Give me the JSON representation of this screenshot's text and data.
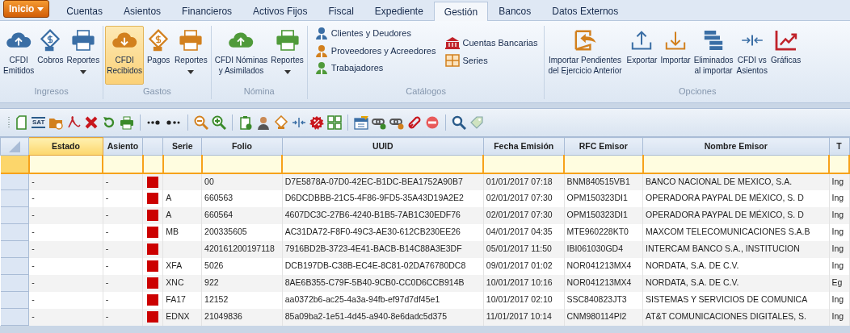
{
  "app_menu": {
    "label": "Inicio"
  },
  "tabs": [
    {
      "label": "Cuentas",
      "selected": false
    },
    {
      "label": "Asientos",
      "selected": false
    },
    {
      "label": "Financieros",
      "selected": false
    },
    {
      "label": "Activos Fijos",
      "selected": false
    },
    {
      "label": "Fiscal",
      "selected": false
    },
    {
      "label": "Expediente",
      "selected": false
    },
    {
      "label": "Gestión",
      "selected": true
    },
    {
      "label": "Bancos",
      "selected": false
    },
    {
      "label": "Datos Externos",
      "selected": false
    }
  ],
  "ribbon_groups": [
    {
      "label": "Ingresos",
      "buttons": [
        {
          "label": "CFDI Emitidos",
          "selected": false,
          "dropdown": false
        },
        {
          "label": "Cobros",
          "selected": false,
          "dropdown": false
        },
        {
          "label": "Reportes",
          "selected": false,
          "dropdown": true
        }
      ]
    },
    {
      "label": "Gastos",
      "buttons": [
        {
          "label": "CFDI Recibidos",
          "selected": true,
          "dropdown": false
        },
        {
          "label": "Pagos",
          "selected": false,
          "dropdown": false
        },
        {
          "label": "Reportes",
          "selected": false,
          "dropdown": true
        }
      ]
    },
    {
      "label": "Nómina",
      "buttons": [
        {
          "label": "CFDI Nóminas y Asimilados",
          "selected": false,
          "dropdown": false
        },
        {
          "label": "Reportes",
          "selected": false,
          "dropdown": true
        }
      ]
    },
    {
      "label": "Catálogos",
      "small_buttons": [
        {
          "label": "Clientes y Deudores"
        },
        {
          "label": "Proveedores y Acreedores"
        },
        {
          "label": "Trabajadores"
        },
        {
          "label": "Cuentas Bancarias"
        },
        {
          "label": "Series"
        }
      ]
    },
    {
      "label": "Opciones",
      "buttons": [
        {
          "label": "Importar Pendientes del Ejercicio Anterior",
          "selected": false,
          "dropdown": false
        },
        {
          "label": "Exportar",
          "selected": false,
          "dropdown": false
        },
        {
          "label": "Importar",
          "selected": false,
          "dropdown": false
        },
        {
          "label": "Eliminados al importar",
          "selected": false,
          "dropdown": false
        },
        {
          "label": "CFDI vs Asientos",
          "selected": false,
          "dropdown": false
        },
        {
          "label": "Gráficas",
          "selected": false,
          "dropdown": false
        }
      ]
    }
  ],
  "toolbar": {
    "sat_label": "SAT"
  },
  "table": {
    "columns": [
      {
        "label": "Estado",
        "selected": true
      },
      {
        "label": "Asiento",
        "selected": false
      },
      {
        "selected": false
      },
      {
        "label": "Serie",
        "selected": false
      },
      {
        "label": "Folio",
        "selected": false
      },
      {
        "label": "UUID",
        "selected": false
      },
      {
        "label": "Fecha Emisión",
        "selected": false
      },
      {
        "label": "RFC Emisor",
        "selected": false
      },
      {
        "label": "Nombre Emisor",
        "selected": false
      },
      {
        "label": "T",
        "selected": false
      }
    ],
    "rows": [
      {
        "estado": "-",
        "asiento": "-",
        "color": "#cc0000",
        "serie": "",
        "folio": "00",
        "uuid": "D7E5878A-07D0-42EC-B1DC-BEA1752A90B7",
        "fecha": "01/01/2017 07:18",
        "rfc": "BNM840515VB1",
        "nombre": "BANCO NACIONAL DE MEXICO, S.A.",
        "column_10": "Ing"
      },
      {
        "estado": "-",
        "asiento": "-",
        "color": "#cc0000",
        "serie": "A",
        "folio": "660563",
        "uuid": "D6DCDBBB-21C5-4F86-9FD5-35A43D19A2E2",
        "fecha": "02/01/2017 07:30",
        "rfc": "OPM150323DI1",
        "nombre": "OPERADORA PAYPAL DE MÉXICO, S. D",
        "column_10": "Ing"
      },
      {
        "estado": "-",
        "asiento": "-",
        "color": "#cc0000",
        "serie": "A",
        "folio": "660564",
        "uuid": "4607DC3C-27B6-4240-B1B5-7AB1C30EDF76",
        "fecha": "02/01/2017 07:30",
        "rfc": "OPM150323DI1",
        "nombre": "OPERADORA PAYPAL DE MÉXICO, S. D",
        "column_10": "Ing"
      },
      {
        "estado": "-",
        "asiento": "-",
        "color": "#cc0000",
        "serie": "MB",
        "folio": "200335605",
        "uuid": "AC31DA72-F8F0-49C3-AE30-612CB230EE26",
        "fecha": "04/01/2017 04:35",
        "rfc": "MTE960228KT0",
        "nombre": "MAXCOM TELECOMUNICACIONES S.A.B",
        "column_10": "Ing"
      },
      {
        "estado": "-",
        "asiento": "-",
        "color": "#cc0000",
        "serie": "",
        "folio": "420161200197118",
        "uuid": "7916BD2B-3723-4E41-BACB-B14C88A3E3DF",
        "fecha": "05/01/2017 11:50",
        "rfc": "IBI061030GD4",
        "nombre": "INTERCAM BANCO S.A., INSTITUCION",
        "column_10": "Ing"
      },
      {
        "estado": "-",
        "asiento": "-",
        "color": "#cc0000",
        "serie": "XFA",
        "folio": "5026",
        "uuid": "DCB197DB-C38B-EC4E-8C81-02DA76780DC8",
        "fecha": "09/01/2017 01:02",
        "rfc": "NOR041213MX4",
        "nombre": "NORDATA, S.A. DE C.V.",
        "column_10": "Ing"
      },
      {
        "estado": "-",
        "asiento": "-",
        "color": "#cc0000",
        "serie": "XNC",
        "folio": "922",
        "uuid": "8AE6B355-C79F-5B40-9CB0-CC0D6CCB914B",
        "fecha": "10/01/2017 10:16",
        "rfc": "NOR041213MX4",
        "nombre": "NORDATA, S.A. DE C.V.",
        "column_10": "Eg"
      },
      {
        "estado": "-",
        "asiento": "-",
        "color": "#cc0000",
        "serie": "FA17",
        "folio": "12152",
        "uuid": "aa0372b6-ac25-4a3a-94fb-ef97d7df45e1",
        "fecha": "10/01/2017 02:10",
        "rfc": "SSC840823JT3",
        "nombre": "SISTEMAS Y SERVICIOS DE COMUNICA",
        "column_10": "Ing"
      },
      {
        "estado": "-",
        "asiento": "-",
        "color": "#cc0000",
        "serie": "EDNX",
        "folio": "21049836",
        "uuid": "85a09ba2-1e51-4d45-a940-8e6dadc5d375",
        "fecha": "11/01/2017 10:14",
        "rfc": "CNM980114PI2",
        "nombre": "AT&T COMUNICACIONES DIGITALES, S.",
        "column_10": "Ing"
      }
    ]
  }
}
